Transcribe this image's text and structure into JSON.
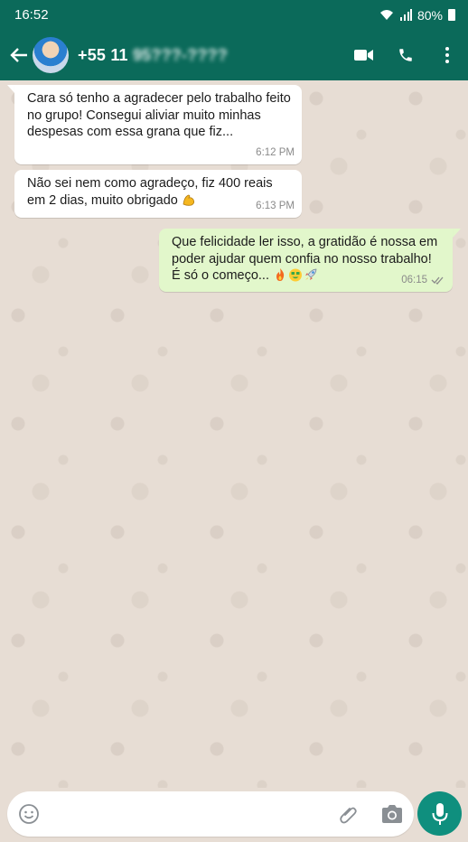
{
  "status": {
    "time": "16:52",
    "battery": "80%"
  },
  "header": {
    "phone_visible": "+55 11",
    "phone_hidden": "95???-????"
  },
  "messages": [
    {
      "dir": "in",
      "text": "Cara só tenho a agradecer pelo trabalho feito no grupo! Consegui aliviar muito minhas despesas com essa grana que fiz...",
      "time": "6:12 PM"
    },
    {
      "dir": "in",
      "text": "Não sei nem como agradeço, fiz 400 reais em 2 dias, muito obrigado",
      "emoji": "flexed-biceps",
      "time": "6:13 PM"
    },
    {
      "dir": "out",
      "text": "Que felicidade ler isso, a gratidão é nossa em poder ajudar quem confia no nosso trabalho! É só o começo...",
      "emojis": [
        "fire",
        "money-face",
        "rocket"
      ],
      "time": "06:15",
      "read": true
    }
  ],
  "composer": {
    "placeholder": ""
  },
  "colors": {
    "header": "#0b6a5a",
    "mic": "#0f8f7e",
    "outgoing_bubble": "#e2f7cb",
    "background": "#e7ddd4",
    "read_ticks": "#8a8a8a"
  }
}
